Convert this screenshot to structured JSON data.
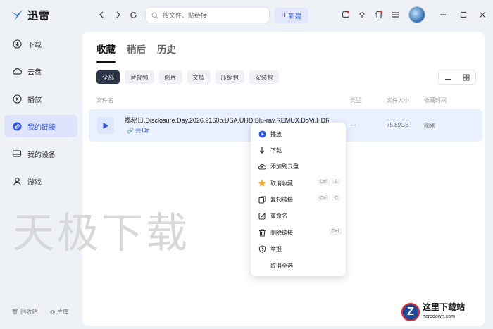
{
  "app": {
    "name": "迅雷"
  },
  "sidebar": {
    "items": [
      {
        "label": "下载",
        "icon": "download-icon"
      },
      {
        "label": "云盘",
        "icon": "cloud-icon"
      },
      {
        "label": "播放",
        "icon": "play-circle-icon"
      },
      {
        "label": "我的链接",
        "icon": "link-icon",
        "active": true
      },
      {
        "label": "我的设备",
        "icon": "device-icon"
      },
      {
        "label": "游戏",
        "icon": "game-icon"
      }
    ],
    "footer": {
      "recycle": "回收站",
      "library": "片库"
    }
  },
  "topbar": {
    "search_placeholder": "搜文件、贴链接",
    "new_label": "新建"
  },
  "main": {
    "tabs": [
      {
        "label": "收藏",
        "active": true
      },
      {
        "label": "稍后"
      },
      {
        "label": "历史"
      }
    ],
    "chips": [
      "全部",
      "音视频",
      "图片",
      "文档",
      "压缩包",
      "安装包"
    ],
    "columns": {
      "name": "文件名",
      "type": "类型",
      "size": "文件大小",
      "time": "收藏时间"
    },
    "row": {
      "name": "揭秘日.Disclosure.Day.2026.2160p.USA.UHD.Blu-ray.REMUX.DoVi.HDR10",
      "sub": "共1项",
      "type": "—",
      "size": "75.89GB",
      "time": "刚刚"
    }
  },
  "context_menu": {
    "items": [
      {
        "label": "播放",
        "icon": "play-icon"
      },
      {
        "label": "下载",
        "icon": "download-arrow-icon"
      },
      {
        "label": "添加到云盘",
        "icon": "cloud-upload-icon"
      },
      {
        "label": "取消收藏",
        "icon": "star-icon",
        "shortcut": [
          "Ctrl",
          "B"
        ]
      },
      {
        "label": "复制链接",
        "icon": "copy-link-icon",
        "shortcut": [
          "Ctrl",
          "C"
        ]
      },
      {
        "label": "重命名",
        "icon": "edit-icon"
      },
      {
        "label": "删除链接",
        "icon": "trash-icon",
        "shortcut": [
          "Del"
        ]
      },
      {
        "label": "举报",
        "icon": "report-icon"
      },
      {
        "label": "取消全选",
        "icon": ""
      }
    ]
  },
  "watermark": "天极下载",
  "site_watermark": {
    "title": "这里下载站",
    "url": "heredown.com",
    "letter": "Z"
  },
  "colors": {
    "accent": "#2f56e6",
    "active_nav_bg": "#dde4fb",
    "chip_active": "#2c3447",
    "star": "#f5a623"
  }
}
